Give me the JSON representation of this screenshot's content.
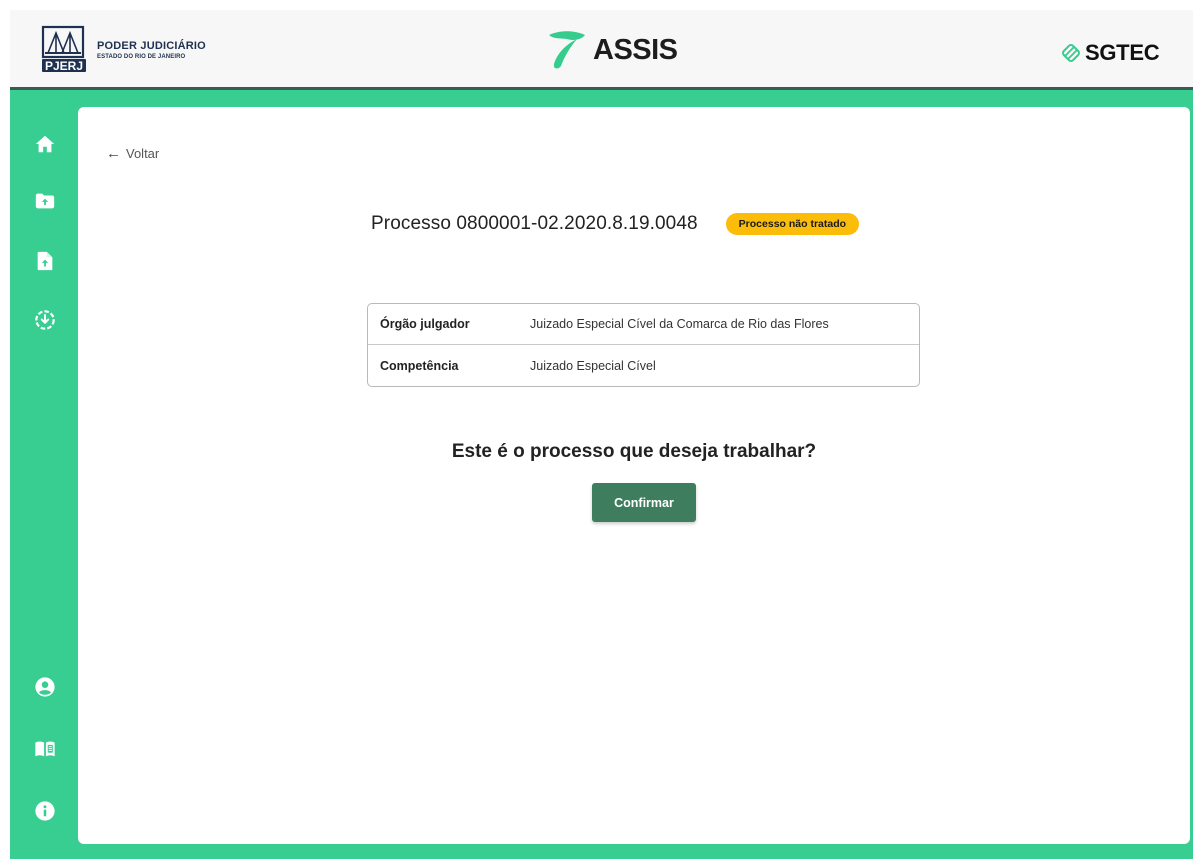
{
  "header": {
    "pjerj": {
      "emblem_text": "PJERJ",
      "title": "PODER JUDICIÁRIO",
      "subtitle": "ESTADO DO RIO DE JANEIRO"
    },
    "assis": {
      "name": "ASSIS"
    },
    "sgtec": {
      "name": "SGTEC"
    }
  },
  "sidebar": {
    "items": [
      {
        "icon": "home-icon"
      },
      {
        "icon": "folder-upload-icon"
      },
      {
        "icon": "file-upload-icon"
      },
      {
        "icon": "download-circle-icon"
      },
      {
        "icon": "user-circle-icon"
      },
      {
        "icon": "manual-book-icon"
      },
      {
        "icon": "info-icon"
      }
    ]
  },
  "main": {
    "back_label": "Voltar",
    "process": {
      "title": "Processo 0800001-02.2020.8.19.0048",
      "status": "Processo não tratado"
    },
    "details": [
      {
        "label": "Órgão julgador",
        "value": "Juizado Especial Cível da Comarca de Rio das Flores"
      },
      {
        "label": "Competência",
        "value": "Juizado Especial Cível"
      }
    ],
    "question": "Este é o processo que deseja trabalhar?",
    "confirm_label": "Confirmar"
  },
  "colors": {
    "accent_green": "#38ce92",
    "header_border": "#3b5a55",
    "confirm_button": "#3e7e5f",
    "badge_yellow": "#fbbd0a",
    "pjerj_navy": "#1e3150"
  }
}
